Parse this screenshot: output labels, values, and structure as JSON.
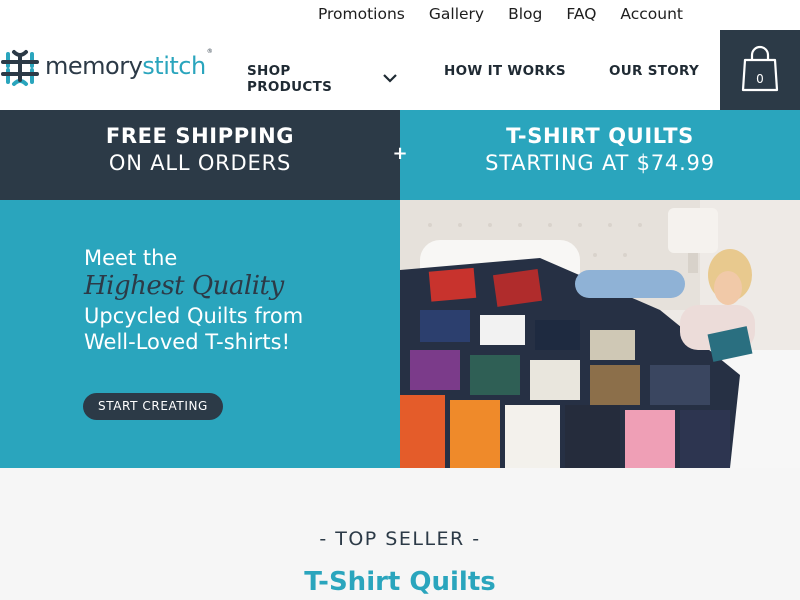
{
  "topbar": {
    "links": [
      "Promotions",
      "Gallery",
      "Blog",
      "FAQ",
      "Account"
    ]
  },
  "header": {
    "logo": {
      "part1": "memory",
      "part2": "stitch",
      "mark": "®"
    },
    "nav": {
      "shop_label": "SHOP PRODUCTS",
      "how_label": "HOW IT WORKS",
      "story_label": "OUR STORY"
    },
    "cart": {
      "count": "0",
      "icon": "shopping-bag-icon"
    }
  },
  "promo": {
    "left": {
      "line1": "FREE SHIPPING",
      "line2": "ON ALL ORDERS"
    },
    "plus": "+",
    "right": {
      "line1": "T-SHIRT QUILTS",
      "line2": "STARTING AT $74.99"
    }
  },
  "hero": {
    "line1": "Meet the",
    "script": "Highest Quality",
    "line2": "Upcycled Quilts from",
    "line3": "Well-Loved T-shirts!",
    "cta": "START CREATING",
    "image": "woman-reading-on-tshirt-quilt-photo"
  },
  "section": {
    "eyebrow": "- TOP SELLER -",
    "title": "T-Shirt Quilts"
  },
  "colors": {
    "teal": "#2aa5bd",
    "navy": "#2c3a47",
    "light_bg": "#f6f6f6"
  }
}
